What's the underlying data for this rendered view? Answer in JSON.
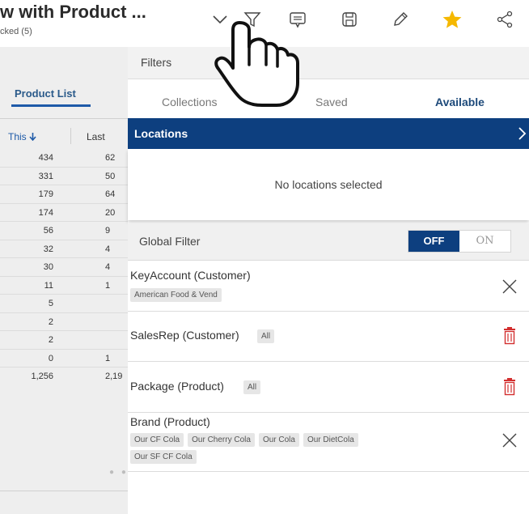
{
  "header": {
    "title": "w with Product ...",
    "subtitle": "cked (5)",
    "icons": [
      "chevron-down-icon",
      "filter-icon",
      "comment-icon",
      "save-icon",
      "edit-icon",
      "star-icon",
      "share-icon"
    ],
    "star_color": "#f5b800"
  },
  "report": {
    "tab_label": "Product List",
    "col_this": "This",
    "col_last": "Last",
    "rows": [
      {
        "this": "434",
        "last": "62"
      },
      {
        "this": "331",
        "last": "50"
      },
      {
        "this": "179",
        "last": "64"
      },
      {
        "this": "174",
        "last": "20"
      },
      {
        "this": "56",
        "last": "9"
      },
      {
        "this": "32",
        "last": "4"
      },
      {
        "this": "30",
        "last": "4"
      },
      {
        "this": "11",
        "last": "1"
      },
      {
        "this": "5",
        "last": ""
      },
      {
        "this": "2",
        "last": ""
      },
      {
        "this": "2",
        "last": ""
      },
      {
        "this": "0",
        "last": "1"
      },
      {
        "this": "1,256",
        "last": "2,19"
      }
    ],
    "dots": "● ●"
  },
  "filters": {
    "title": "Filters",
    "tabs": [
      {
        "label": "Collections",
        "active": false
      },
      {
        "label": "Saved",
        "active": false
      },
      {
        "label": "Available",
        "active": true
      }
    ],
    "locations": {
      "label": "Locations",
      "empty_text": "No locations selected",
      "bar_color": "#0d3f7f"
    },
    "global_filter": {
      "label": "Global Filter",
      "off_label": "OFF",
      "on_label": "ON",
      "selected": "OFF"
    },
    "rows": [
      {
        "label": "KeyAccount (Customer)",
        "chips": [
          "American Food & Vend"
        ],
        "action": "close-icon"
      },
      {
        "label": "SalesRep (Customer)",
        "inline_chip": "All",
        "action": "trash-icon"
      },
      {
        "label": "Package (Product)",
        "inline_chip": "All",
        "action": "trash-icon"
      },
      {
        "label": "Brand (Product)",
        "chips": [
          "Our CF Cola",
          "Our Cherry Cola",
          "Our Cola",
          "Our DietCola",
          "Our SF CF Cola"
        ],
        "action": "close-icon"
      }
    ],
    "trash_color": "#d32f2f"
  }
}
